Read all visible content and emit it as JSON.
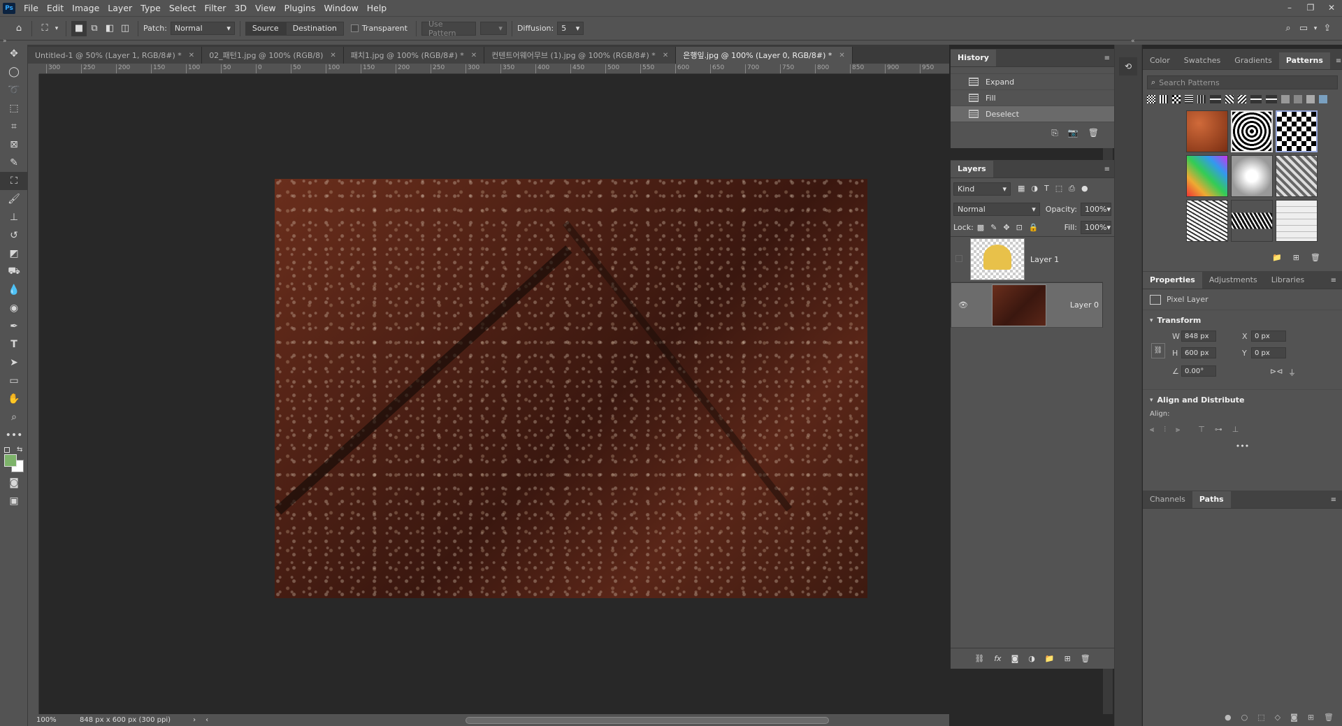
{
  "app": {
    "logo": "Ps"
  },
  "menu": [
    "File",
    "Edit",
    "Image",
    "Layer",
    "Type",
    "Select",
    "Filter",
    "3D",
    "View",
    "Plugins",
    "Window",
    "Help"
  ],
  "window_controls": {
    "minimize": "–",
    "restore": "❐",
    "close": "✕"
  },
  "options": {
    "patch_label": "Patch:",
    "patch_value": "Normal",
    "source_label": "Source",
    "destination_label": "Destination",
    "transparent_label": "Transparent",
    "use_pattern_label": "Use Pattern",
    "diffusion_label": "Diffusion:",
    "diffusion_value": "5"
  },
  "tabs": [
    {
      "label": "Untitled-1 @ 50% (Layer 1, RGB/8#) *"
    },
    {
      "label": "02_패턴1.jpg @ 100% (RGB/8)"
    },
    {
      "label": "패치1.jpg @ 100% (RGB/8#) *"
    },
    {
      "label": "컨텐트어웨어무브 (1).jpg @ 100% (RGB/8#) *"
    },
    {
      "label": "은행잎.jpg @ 100% (Layer 0, RGB/8#) *"
    }
  ],
  "ruler_h": [
    "300",
    "250",
    "200",
    "150",
    "100",
    "50",
    "0",
    "50",
    "100",
    "150",
    "200",
    "250",
    "300",
    "350",
    "400",
    "450",
    "500",
    "550",
    "600",
    "650",
    "700",
    "750",
    "800",
    "850",
    "900",
    "950"
  ],
  "status": {
    "zoom": "100%",
    "doc_info": "848 px x 600 px (300 ppi)"
  },
  "history": {
    "title": "History",
    "items": [
      {
        "label": "Expand",
        "current": false
      },
      {
        "label": "Fill",
        "current": false
      },
      {
        "label": "Deselect",
        "current": true
      }
    ]
  },
  "layers": {
    "title": "Layers",
    "kind_label": "Kind",
    "blend_mode": "Normal",
    "opacity_label": "Opacity:",
    "opacity_value": "100%",
    "lock_label": "Lock:",
    "fill_label": "Fill:",
    "fill_value": "100%",
    "items": [
      {
        "name": "Layer 1",
        "visible": false,
        "selected": false
      },
      {
        "name": "Layer 0",
        "visible": true,
        "selected": true
      }
    ]
  },
  "right_tabs": {
    "color": "Color",
    "swatches": "Swatches",
    "gradients": "Gradients",
    "patterns": "Patterns"
  },
  "patterns_search_placeholder": "Search Patterns",
  "properties": {
    "tabs": {
      "properties": "Properties",
      "adjustments": "Adjustments",
      "libraries": "Libraries"
    },
    "type_label": "Pixel Layer",
    "transform_label": "Transform",
    "w_label": "W",
    "w_value": "848 px",
    "h_label": "H",
    "h_value": "600 px",
    "x_label": "X",
    "x_value": "0 px",
    "y_label": "Y",
    "y_value": "0 px",
    "angle_value": "0.00°",
    "align_distribute_label": "Align and Distribute",
    "align_label": "Align:"
  },
  "bottom_tabs": {
    "channels": "Channels",
    "paths": "Paths"
  }
}
